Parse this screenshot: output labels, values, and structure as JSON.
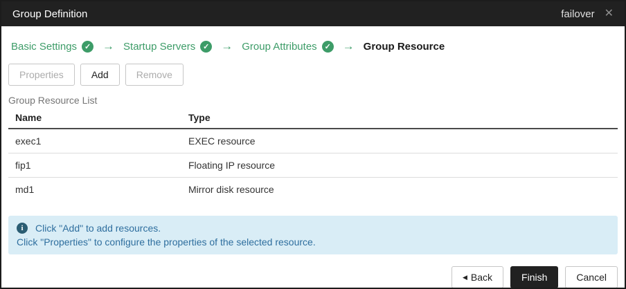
{
  "titlebar": {
    "title": "Group Definition",
    "context": "failover",
    "close_glyph": "✕"
  },
  "steps": {
    "check_glyph": "✓",
    "arrow_glyph": "→",
    "items": [
      {
        "label": "Basic Settings",
        "completed": true,
        "current": false
      },
      {
        "label": "Startup Servers",
        "completed": true,
        "current": false
      },
      {
        "label": "Group Attributes",
        "completed": true,
        "current": false
      },
      {
        "label": "Group Resource",
        "completed": false,
        "current": true
      }
    ]
  },
  "toolbar": {
    "properties_label": "Properties",
    "add_label": "Add",
    "remove_label": "Remove"
  },
  "resource_list": {
    "label": "Group Resource List",
    "columns": [
      "Name",
      "Type"
    ],
    "rows": [
      {
        "name": "exec1",
        "type": "EXEC resource"
      },
      {
        "name": "fip1",
        "type": "Floating IP resource"
      },
      {
        "name": "md1",
        "type": "Mirror disk resource"
      }
    ]
  },
  "info": {
    "icon_glyph": "i",
    "line1": "Click \"Add\" to add resources.",
    "line2": "Click \"Properties\" to configure the properties of the selected resource."
  },
  "footer": {
    "back_arrow": "◀",
    "back_label": "Back",
    "finish_label": "Finish",
    "cancel_label": "Cancel"
  },
  "colors": {
    "accent_green": "#3d9c68",
    "titlebar_bg": "#212121",
    "info_bg": "#d9edf6",
    "info_text": "#2e6e9e"
  }
}
